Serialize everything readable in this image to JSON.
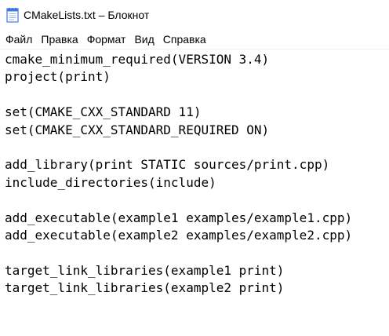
{
  "window": {
    "title": "CMakeLists.txt – Блокнот",
    "icon": "notepad-icon"
  },
  "menu": [
    {
      "label": "Файл"
    },
    {
      "label": "Правка"
    },
    {
      "label": "Формат"
    },
    {
      "label": "Вид"
    },
    {
      "label": "Справка"
    }
  ],
  "editor": {
    "lines": [
      "cmake_minimum_required(VERSION 3.4)",
      "project(print)",
      "",
      "set(CMAKE_CXX_STANDARD 11)",
      "set(CMAKE_CXX_STANDARD_REQUIRED ON)",
      "",
      "add_library(print STATIC sources/print.cpp)",
      "include_directories(include)",
      "",
      "add_executable(example1 examples/example1.cpp)",
      "add_executable(example2 examples/example2.cpp)",
      "",
      "target_link_libraries(example1 print)",
      "target_link_libraries(example2 print)"
    ]
  },
  "colors": {
    "text": "#000000",
    "background": "#ffffff",
    "icon_blue": "#3b7ddd"
  }
}
